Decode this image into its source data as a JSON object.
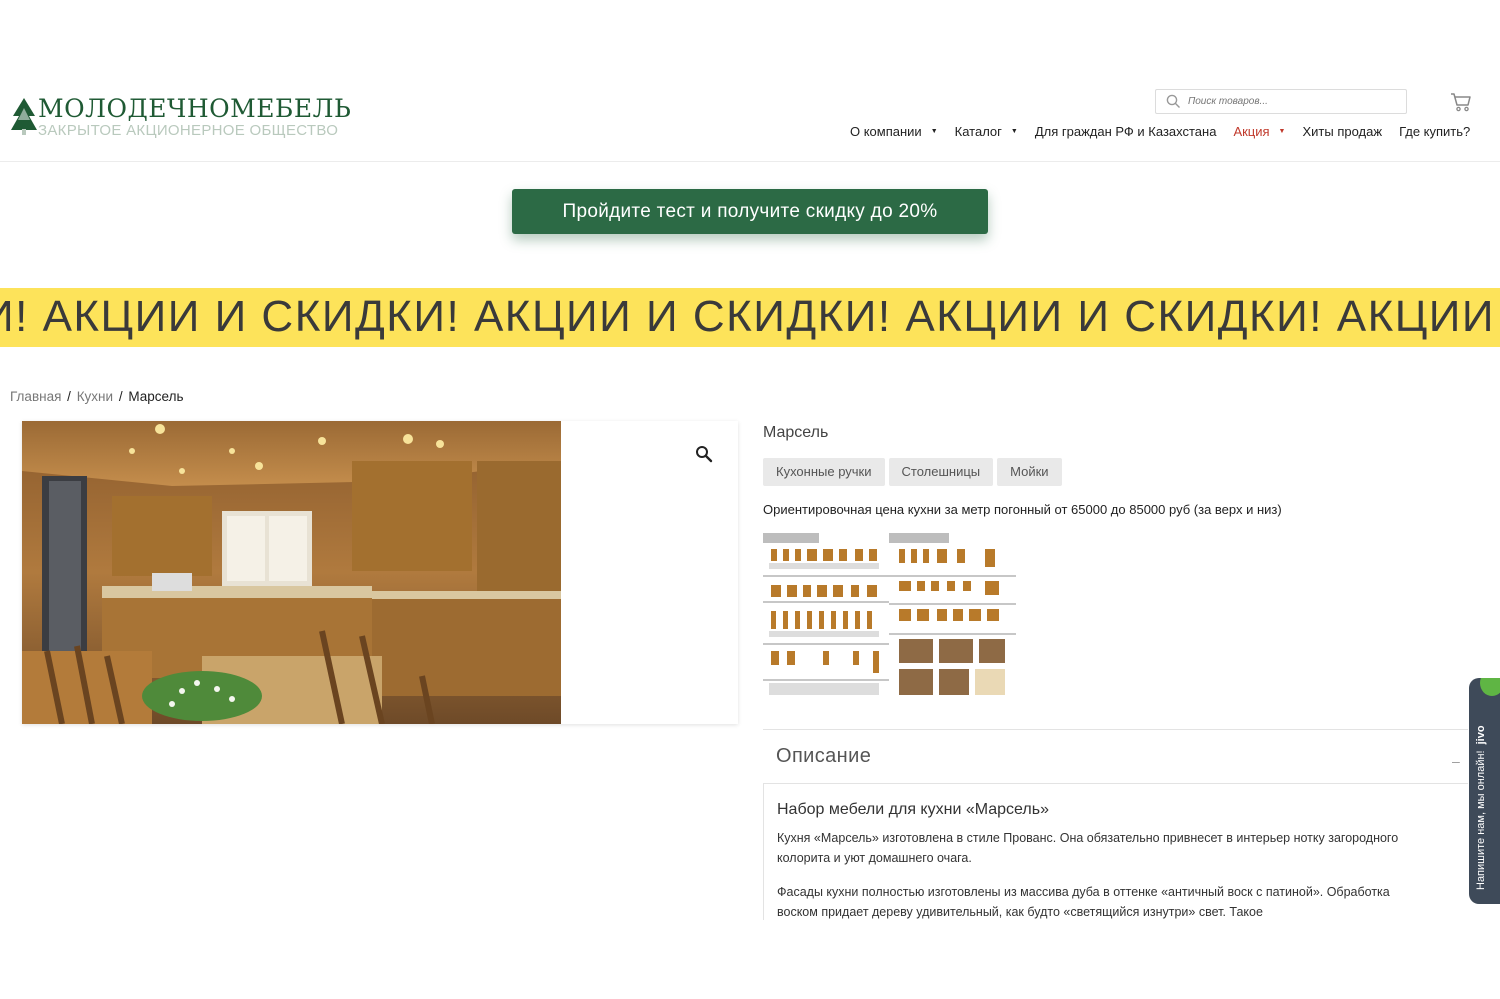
{
  "header": {
    "logo_name": "МОЛОДЕЧНОМЕБЕЛЬ",
    "logo_subtitle": "ЗАКРЫТОЕ АКЦИОНЕРНОЕ ОБЩЕСТВО",
    "search_placeholder": "Поиск товаров...",
    "nav": [
      {
        "label": "О компании",
        "has_caret": true
      },
      {
        "label": "Каталог",
        "has_caret": true
      },
      {
        "label": "Для граждан РФ и Казахстана",
        "has_caret": false
      },
      {
        "label": "Акция",
        "has_caret": true,
        "active": true
      },
      {
        "label": "Хиты продаж",
        "has_caret": false
      },
      {
        "label": "Где купить?",
        "has_caret": false
      }
    ],
    "caret_glyph": "▼"
  },
  "promo": {
    "button_label": "Пройдите тест и получите скидку до 20%",
    "color": "#2c6a45"
  },
  "ticker": {
    "text": "И! АКЦИИ И СКИДКИ! АКЦИИ И СКИДКИ! АКЦИИ И СКИДКИ! АКЦИИ",
    "background": "#fde35a"
  },
  "breadcrumb": {
    "home": "Главная",
    "category": "Кухни",
    "current": "Марсель",
    "separator": "/"
  },
  "product": {
    "title": "Марсель",
    "tags": [
      "Кухонные ручки",
      "Столешницы",
      "Мойки"
    ],
    "price_note": "Ориентировочная цена кухни за метр погонный от 65000 до 85000 руб (за верх и низ)"
  },
  "description": {
    "tab_label": "Описание",
    "collapse_glyph": "–",
    "heading": "Набор мебели для кухни «Марсель»",
    "paragraphs": [
      "Кухня «Марсель» изготовлена в стиле Прованс. Она обязательно привнесет в интерьер нотку загородного колорита и уют домашнего очага.",
      "Фасады кухни полностью изготовлены из массива дуба в оттенке «античный воск с патиной». Обработка воском придает дереву удивительный, как будто «светящийся изнутри» свет. Такое"
    ]
  },
  "chat": {
    "label": "Напишите нам, мы онлайн!",
    "brand": "jivo"
  },
  "icons": {
    "search": "search-icon",
    "cart": "cart-icon",
    "zoom": "zoom-icon"
  }
}
